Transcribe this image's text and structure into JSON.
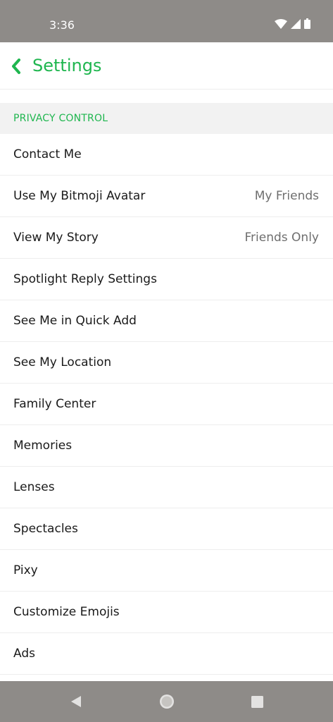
{
  "status_bar": {
    "time": "3:36"
  },
  "header": {
    "title": "Settings",
    "back_icon": "chevron-left-icon"
  },
  "section": {
    "title": "PRIVACY CONTROL"
  },
  "rows": [
    {
      "label": "Contact Me",
      "value": ""
    },
    {
      "label": "Use My Bitmoji Avatar",
      "value": "My Friends"
    },
    {
      "label": "View My Story",
      "value": "Friends Only"
    },
    {
      "label": "Spotlight Reply Settings",
      "value": ""
    },
    {
      "label": "See Me in Quick Add",
      "value": ""
    },
    {
      "label": "See My Location",
      "value": ""
    },
    {
      "label": "Family Center",
      "value": ""
    },
    {
      "label": "Memories",
      "value": ""
    },
    {
      "label": "Lenses",
      "value": ""
    },
    {
      "label": "Spectacles",
      "value": ""
    },
    {
      "label": "Pixy",
      "value": ""
    },
    {
      "label": "Customize Emojis",
      "value": ""
    },
    {
      "label": "Ads",
      "value": ""
    }
  ],
  "colors": {
    "accent": "#1fb64f",
    "system_bar": "#8e8b88",
    "section_bg": "#f2f2f2",
    "secondary_text": "#6e6e6e"
  },
  "nav_bar": {
    "icons": [
      "back-triangle-icon",
      "home-circle-icon",
      "recents-square-icon"
    ]
  }
}
